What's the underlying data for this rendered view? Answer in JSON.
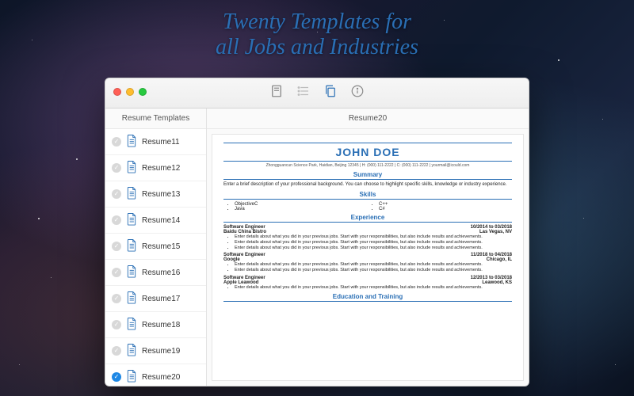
{
  "promo": {
    "line1": "Twenty Templates for",
    "line2": "all Jobs and Industries"
  },
  "sidebar": {
    "header": "Resume Templates",
    "items": [
      {
        "label": "Resume11",
        "selected": false
      },
      {
        "label": "Resume12",
        "selected": false
      },
      {
        "label": "Resume13",
        "selected": false
      },
      {
        "label": "Resume14",
        "selected": false
      },
      {
        "label": "Resume15",
        "selected": false
      },
      {
        "label": "Resume16",
        "selected": false
      },
      {
        "label": "Resume17",
        "selected": false
      },
      {
        "label": "Resume18",
        "selected": false
      },
      {
        "label": "Resume19",
        "selected": false
      },
      {
        "label": "Resume20",
        "selected": true
      }
    ]
  },
  "content": {
    "title": "Resume20"
  },
  "resume": {
    "name": "JOHN DOE",
    "contact": "Zhongguancun Science Park, Haidian, Beijing 12345 | H: (000) 111-2222 | C: (000) 111-2222 | yourmail@icould.com",
    "sections": {
      "summary": {
        "heading": "Summary",
        "text": "Enter a brief description of your professional background. You can choose to highlight specific skills, knowledge or industry experience."
      },
      "skills": {
        "heading": "Skills",
        "left": [
          "ObjectiveC",
          "Java"
        ],
        "right": [
          "C++",
          "C#"
        ]
      },
      "experience": {
        "heading": "Experience",
        "jobs": [
          {
            "title": "Software Engineer",
            "dates": "10/2014 to 03/2018",
            "company": "Baidu China Bistro",
            "location": "Las Vegas, NV",
            "bullets": [
              "Enter details about what you did in your previous jobs. Start with your responsibilities, but also include results and achievements.",
              "Enter details about what you did in your previous jobs. Start with your responsibilities, but also include results and achievements.",
              "Enter details about what you did in your previous jobs. Start with your responsibilities, but also include results and achievements."
            ]
          },
          {
            "title": "Software Engineer",
            "dates": "11/2018 to 04/2018",
            "company": "Google",
            "location": "Chicago, IL",
            "bullets": [
              "Enter details about what you did in your previous jobs. Start with your responsibilities, but also include results and achievements.",
              "Enter details about what you did in your previous jobs. Start with your responsibilities, but also include results and achievements."
            ]
          },
          {
            "title": "Software Engineer",
            "dates": "12/2013 to 03/2018",
            "company": "Apple Leawood",
            "location": "Leawood, KS",
            "bullets": [
              "Enter details about what you did in your previous jobs. Start with your responsibilities, but also include results and achievements."
            ]
          }
        ]
      },
      "education": {
        "heading": "Education and Training"
      }
    }
  }
}
